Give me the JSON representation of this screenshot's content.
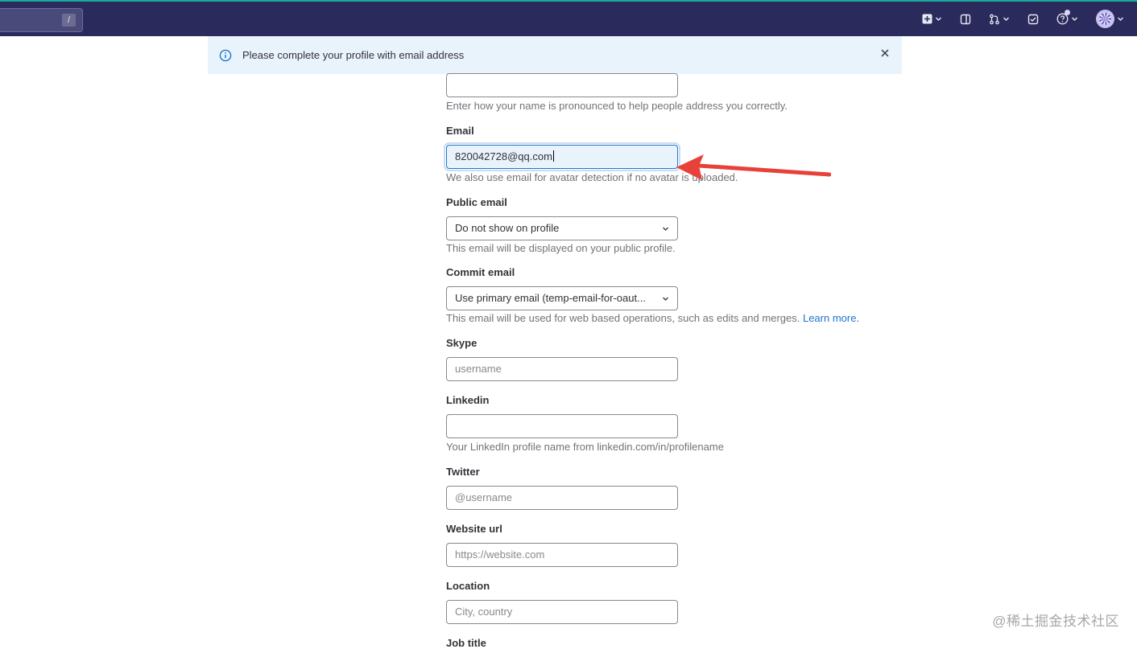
{
  "nav": {
    "search_shortcut": "/",
    "icons": [
      "plus-square-icon",
      "sidebar-icon",
      "merge-request-icon",
      "todo-icon",
      "help-icon",
      "avatar"
    ]
  },
  "alert": {
    "message": "Please complete your profile with email address"
  },
  "form": {
    "name_pronunciation": {
      "value": "",
      "help": "Enter how your name is pronounced to help people address you correctly."
    },
    "email": {
      "label": "Email",
      "value": "820042728@qq.com",
      "help": "We also use email for avatar detection if no avatar is uploaded."
    },
    "public_email": {
      "label": "Public email",
      "selected": "Do not show on profile",
      "help": "This email will be displayed on your public profile."
    },
    "commit_email": {
      "label": "Commit email",
      "selected": "Use primary email (temp-email-for-oaut...",
      "help": "This email will be used for web based operations, such as edits and merges.",
      "help_link": "Learn more."
    },
    "skype": {
      "label": "Skype",
      "placeholder": "username"
    },
    "linkedin": {
      "label": "Linkedin",
      "value": "",
      "help": "Your LinkedIn profile name from linkedin.com/in/profilename"
    },
    "twitter": {
      "label": "Twitter",
      "placeholder": "@username"
    },
    "website": {
      "label": "Website url",
      "placeholder": "https://website.com"
    },
    "location": {
      "label": "Location",
      "placeholder": "City, country"
    },
    "job_title": {
      "label": "Job title"
    }
  },
  "watermark": "@稀土掘金技术社区",
  "colors": {
    "nav_bg": "#2b2a5c",
    "alert_bg": "#e9f3fc",
    "link": "#1f75cb",
    "arrow": "#e8413a"
  }
}
